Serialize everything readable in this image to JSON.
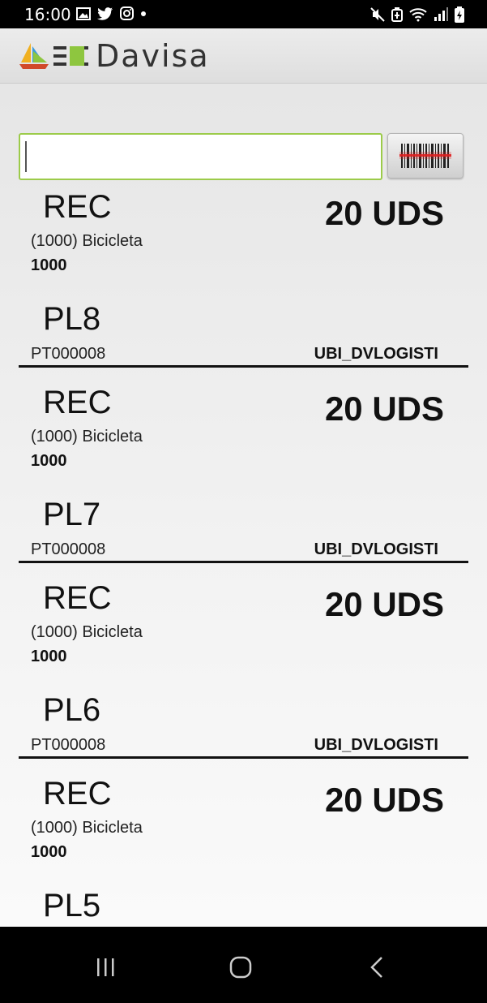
{
  "status_bar": {
    "time": "16:00",
    "left_icons": [
      "image-icon",
      "twitter-icon",
      "instagram-icon",
      "dot-icon"
    ],
    "right_icons": [
      "mute-icon",
      "battery-saver-icon",
      "wifi-icon",
      "signal-icon",
      "battery-icon"
    ]
  },
  "header": {
    "brand": "Davisa",
    "logo_icons": [
      "sailboat-logo-icon",
      "equals-logo-icon"
    ]
  },
  "search": {
    "value": "",
    "placeholder": ""
  },
  "scan_button": {
    "icon": "barcode-scanner-icon"
  },
  "records": [
    {
      "type": "REC",
      "quantity": "20 UDS",
      "description": "(1000) Bicicleta",
      "code": "1000",
      "pallet": "PL8",
      "lot": "PT000008",
      "location": "UBI_DVLOGISTI"
    },
    {
      "type": "REC",
      "quantity": "20 UDS",
      "description": "(1000) Bicicleta",
      "code": "1000",
      "pallet": "PL7",
      "lot": "PT000008",
      "location": "UBI_DVLOGISTI"
    },
    {
      "type": "REC",
      "quantity": "20 UDS",
      "description": "(1000) Bicicleta",
      "code": "1000",
      "pallet": "PL6",
      "lot": "PT000008",
      "location": "UBI_DVLOGISTI"
    },
    {
      "type": "REC",
      "quantity": "20 UDS",
      "description": "(1000) Bicicleta",
      "code": "1000",
      "pallet": "PL5",
      "lot": "",
      "location": ""
    }
  ],
  "nav": {
    "icons": [
      "recent-apps-icon",
      "home-icon",
      "back-icon"
    ]
  },
  "colors": {
    "accent_border": "#9ccb4a",
    "scan_line": "#e02020",
    "status_bar_bg": "#000000"
  }
}
